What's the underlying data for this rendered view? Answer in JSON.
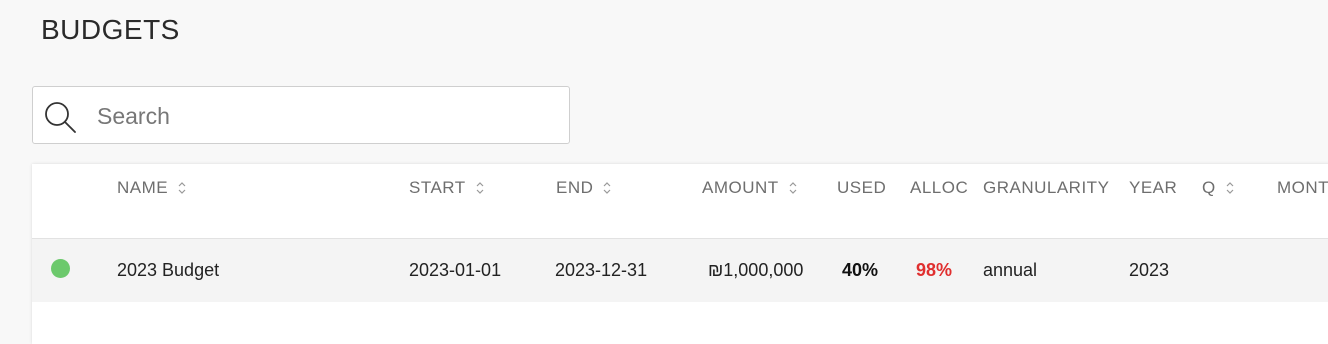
{
  "page": {
    "title": "BUDGETS"
  },
  "search": {
    "placeholder": "Search",
    "value": ""
  },
  "table": {
    "columns": [
      {
        "key": "name",
        "label": "NAME",
        "sortable": true
      },
      {
        "key": "start",
        "label": "START",
        "sortable": true
      },
      {
        "key": "end",
        "label": "END",
        "sortable": true
      },
      {
        "key": "amount",
        "label": "AMOUNT",
        "sortable": true
      },
      {
        "key": "used",
        "label": "USED",
        "sortable": false
      },
      {
        "key": "alloc",
        "label": "ALLOC",
        "sortable": false
      },
      {
        "key": "granularity",
        "label": "GRANULARITY",
        "sortable": false
      },
      {
        "key": "year",
        "label": "YEAR",
        "sortable": false
      },
      {
        "key": "q",
        "label": "Q",
        "sortable": true
      },
      {
        "key": "month",
        "label": "MONT",
        "sortable": false
      }
    ],
    "rows": [
      {
        "status_color": "#6cc96c",
        "name": "2023 Budget",
        "start": "2023-01-01",
        "end": "2023-12-31",
        "amount": "₪1,000,000",
        "used": "40%",
        "alloc": "98%",
        "granularity": "annual",
        "year": "2023",
        "q": "",
        "month": ""
      }
    ]
  },
  "colors": {
    "status_active": "#6cc96c",
    "alloc_warning": "#e02f2f"
  }
}
